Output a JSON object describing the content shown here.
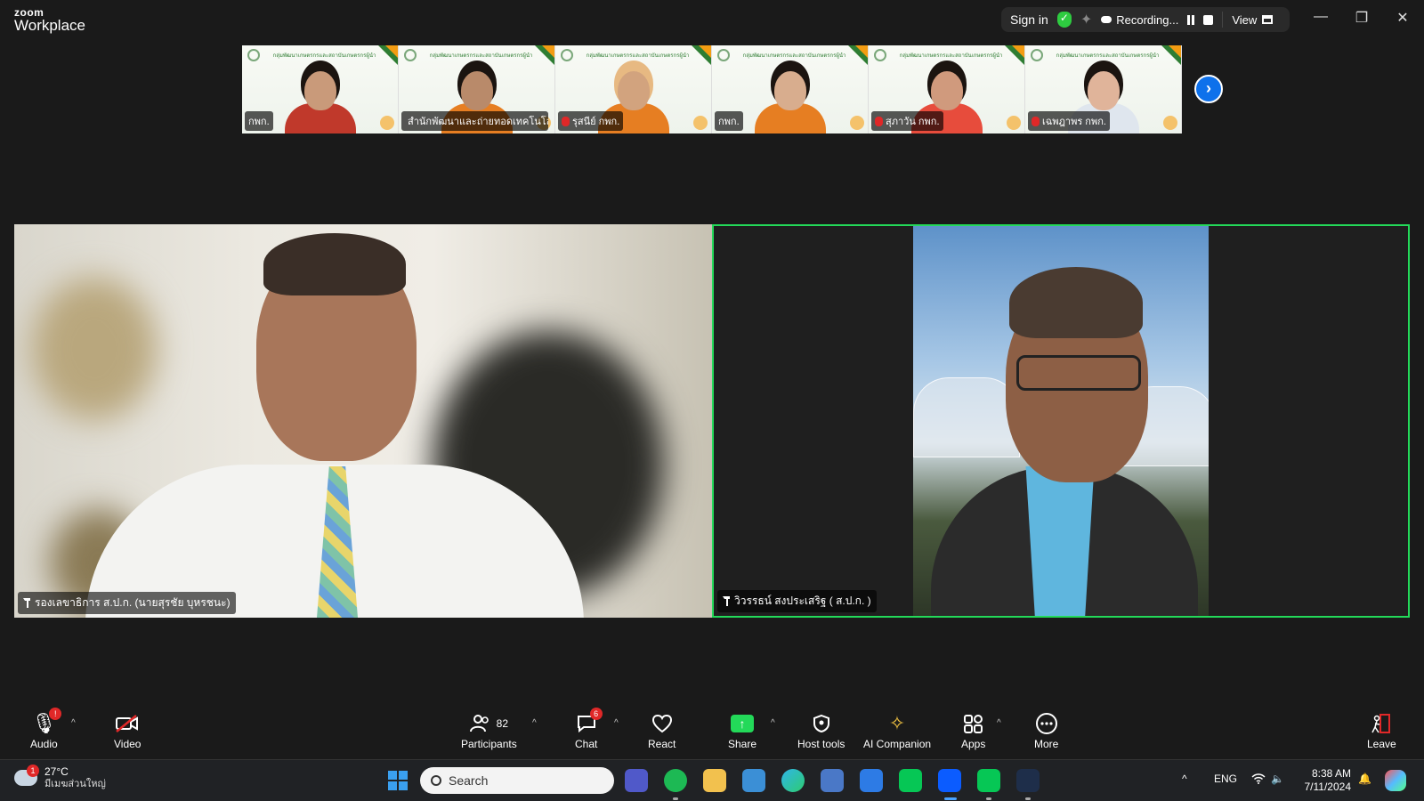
{
  "window": {
    "logo_small": "zoom",
    "logo_big": "Workplace",
    "sign_in": "Sign in",
    "recording_label": "Recording...",
    "view_label": "View",
    "controls": [
      "minimize",
      "restore",
      "close"
    ]
  },
  "gallery": {
    "banner_text": "กลุ่มพัฒนาเกษตรกรและสถาบันเกษตรกรผู้นำ",
    "tiles": [
      {
        "name": "กพก.",
        "muted": false,
        "skin": "#c99a7a",
        "hair": "#1b1410",
        "shirt": "#c0392b"
      },
      {
        "name": "สำนักพัฒนาและถ่ายทอดเทคโนโลยี",
        "muted": true,
        "skin": "#b98a6a",
        "hair": "#1b1410",
        "shirt": "#e67e22"
      },
      {
        "name": "รุสนีย์ กพก.",
        "muted": true,
        "skin": "#d2a37e",
        "hair": "#e7b982",
        "shirt": "#e67e22"
      },
      {
        "name": "กพก.",
        "muted": false,
        "skin": "#d8ad8e",
        "hair": "#1b1410",
        "shirt": "#e67e22"
      },
      {
        "name": "สุภาวัน กพก.",
        "muted": true,
        "skin": "#d09a7d",
        "hair": "#1b1410",
        "shirt": "#e74c3c"
      },
      {
        "name": "เฉพฎาพร กพก.",
        "muted": true,
        "skin": "#e0b49a",
        "hair": "#1b1410",
        "shirt": "#dfe6ee"
      }
    ]
  },
  "speakers": {
    "left_name": "รองเลขาธิการ ส.ป.ก. (นายสุรชัย บุหรชนะ)",
    "right_name": "วิวรรธน์ สงประเสริฐ ( ส.ป.ก. )"
  },
  "toolbar": {
    "audio": "Audio",
    "audio_badge": "!",
    "video": "Video",
    "participants": "Participants",
    "participants_count": "82",
    "chat": "Chat",
    "chat_badge": "6",
    "react": "React",
    "share": "Share",
    "host_tools": "Host tools",
    "ai_companion": "AI Companion",
    "apps": "Apps",
    "more": "More",
    "leave": "Leave"
  },
  "taskbar": {
    "weather_temp": "27°C",
    "weather_cond": "มีเมฆส่วนใหญ่",
    "weather_badge": "1",
    "search_placeholder": "Search",
    "language": "ENG",
    "time": "8:38 AM",
    "date": "7/11/2024"
  },
  "colors": {
    "active_speaker_border": "#23d959",
    "share_green": "#23d959",
    "badge_red": "#e02828",
    "zoom_blue": "#0e71eb"
  }
}
